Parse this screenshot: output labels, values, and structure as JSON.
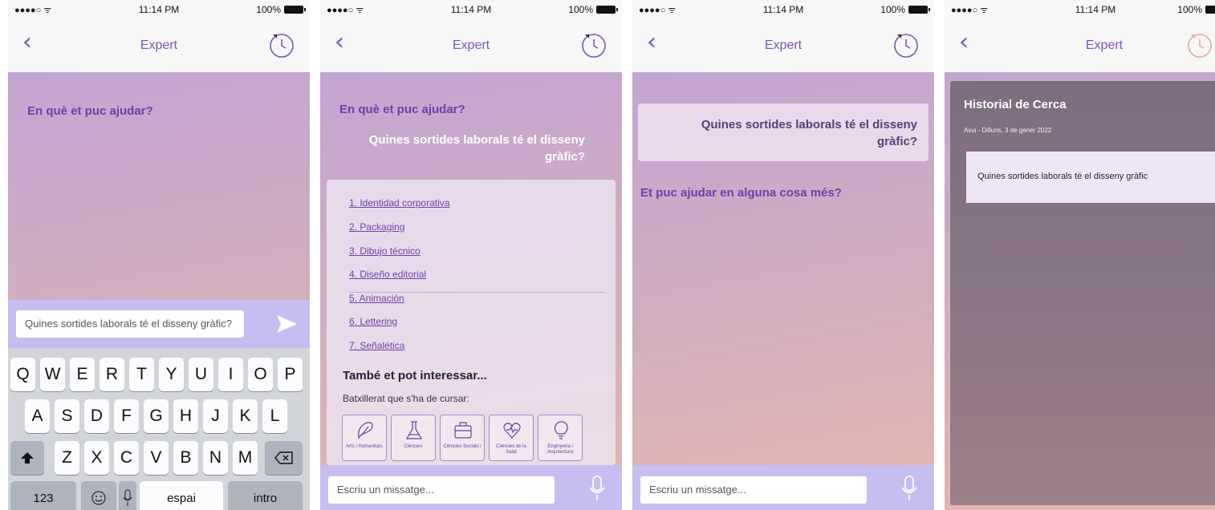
{
  "status": {
    "carrier": "●●●●○ ᯤ",
    "time": "11:14 PM",
    "battery": "100%"
  },
  "nav": {
    "title": "Expert"
  },
  "screen1": {
    "prompt": "En què et puc ajudar?",
    "input_value": "Quines sortides laborals té el disseny gràfic?",
    "keyboard": {
      "row1": [
        "Q",
        "W",
        "E",
        "R",
        "T",
        "Y",
        "U",
        "I",
        "O",
        "P"
      ],
      "row2": [
        "A",
        "S",
        "D",
        "F",
        "G",
        "H",
        "J",
        "K",
        "L"
      ],
      "row3": [
        "Z",
        "X",
        "C",
        "V",
        "B",
        "N",
        "M"
      ],
      "numbers": "123",
      "space": "espai",
      "enter": "intro"
    }
  },
  "screen2": {
    "prompt": "En què et puc ajudar?",
    "question": "Quines sortides laborals té el disseny gràfic?",
    "links": [
      "1. Identidad corporativa",
      "2. Packaging",
      "3. Dibujo técnico",
      "4. Diseño editorial",
      "5. Animación",
      "6. Lettering",
      "7. Señalética"
    ],
    "interest_title": "També et pot interessar...",
    "interest_sub": "Batxillerat que s'ha de cursar:",
    "categories": [
      {
        "label": "Arts i Humanitats",
        "icon": "brush-icon"
      },
      {
        "label": "Ciències",
        "icon": "flask-icon"
      },
      {
        "label": "Ciències Socials i",
        "icon": "briefcase-icon"
      },
      {
        "label": "Ciències de la Salut",
        "icon": "heart-pulse-icon"
      },
      {
        "label": "Enginyeria i Arquitectura",
        "icon": "lightbulb-icon"
      }
    ],
    "input_placeholder": "Escriu un missatge..."
  },
  "screen3": {
    "question": "Quines sortides laborals té el disseny gràfic?",
    "followup": "Et puc ajudar en alguna cosa més?",
    "input_placeholder": "Escriu un missatge..."
  },
  "screen4": {
    "history_title": "Historial de Cerca",
    "history_date": "Avui - Dilluns, 3 de gener 2022",
    "history_item": "Quines sortides laborals té el disseny gràfic"
  },
  "colors": {
    "accent": "#7a55c0",
    "input_bar": "#c8bdf0",
    "history_icon_active": "#e8a79a"
  }
}
